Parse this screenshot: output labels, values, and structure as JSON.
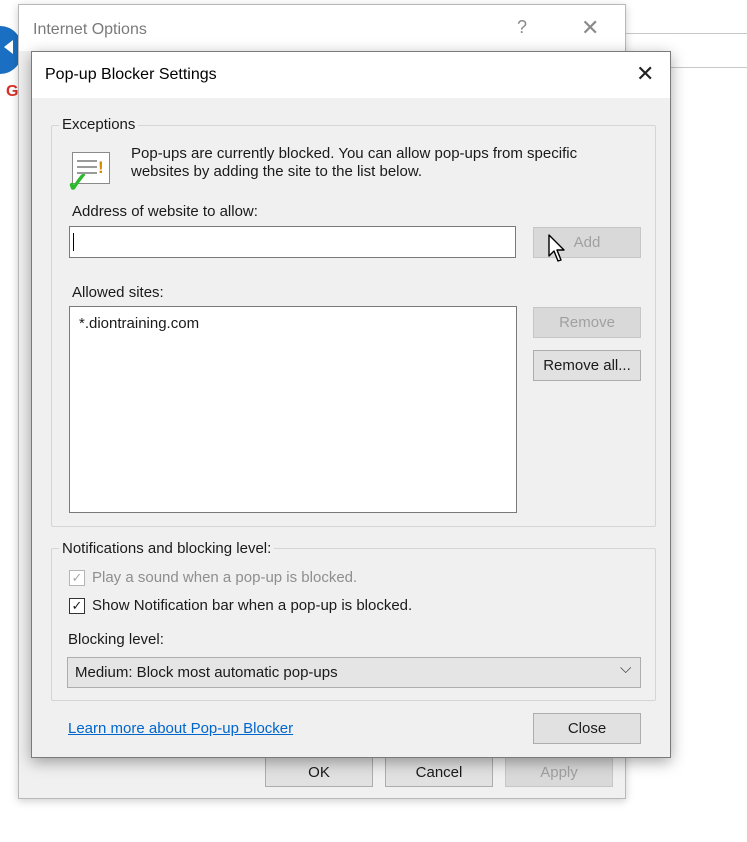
{
  "internet_options": {
    "title": "Internet Options",
    "help_glyph": "?",
    "close_glyph": "✕",
    "buttons": {
      "ok": "OK",
      "cancel": "Cancel",
      "apply": "Apply"
    }
  },
  "dialog": {
    "title": "Pop-up Blocker Settings",
    "close_glyph": "✕",
    "exceptions": {
      "group_label": "Exceptions",
      "description": "Pop-ups are currently blocked.  You can allow pop-ups from specific websites by adding the site to the list below.",
      "address_label": "Address of website to allow:",
      "address_value": "",
      "add_button": "Add",
      "allowed_label": "Allowed sites:",
      "allowed_sites": [
        "*.diontraining.com"
      ],
      "remove_button": "Remove",
      "remove_all_button": "Remove all..."
    },
    "notifications": {
      "group_label": "Notifications and blocking level:",
      "play_sound": {
        "label": "Play a sound when a pop-up is blocked.",
        "checked": true,
        "enabled": false
      },
      "show_bar": {
        "label": "Show Notification bar when a pop-up is blocked.",
        "checked": true,
        "enabled": true
      },
      "blocking_label": "Blocking level:",
      "blocking_value": "Medium: Block most automatic pop-ups"
    },
    "learn_more_link": "Learn more about Pop-up Blocker",
    "close_button": "Close"
  },
  "icons": {
    "check_mark": "✓",
    "chevron_down": "⌵",
    "browser_letter": "G"
  }
}
